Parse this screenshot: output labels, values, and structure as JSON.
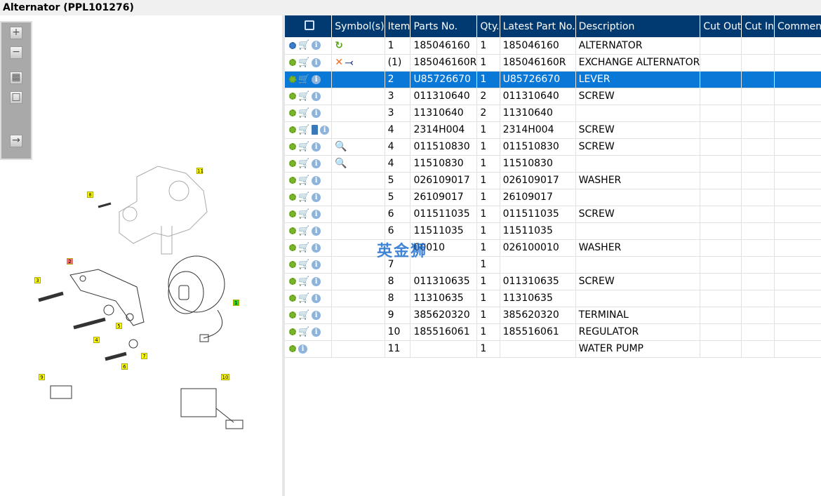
{
  "title": "Alternator (PPL101276)",
  "watermark": "英金狮",
  "toolbar": [
    "zoom-in",
    "zoom-out",
    "fit-all",
    "fit-window",
    "export"
  ],
  "callouts": [
    {
      "label": "11",
      "color": "#ffff00"
    },
    {
      "label": "8",
      "color": "#ffff00"
    },
    {
      "label": "2",
      "color": "#ff6a6a"
    },
    {
      "label": "3",
      "color": "#ffff00"
    },
    {
      "label": "1",
      "color": "#22dd22"
    },
    {
      "label": "5",
      "color": "#ffff00"
    },
    {
      "label": "4",
      "color": "#ffff00"
    },
    {
      "label": "7",
      "color": "#ffff00"
    },
    {
      "label": "6",
      "color": "#ffff00"
    },
    {
      "label": "9",
      "color": "#ffff00"
    },
    {
      "label": "10",
      "color": "#ffff00"
    }
  ],
  "columns": [
    "",
    "Symbol(s)",
    "Item",
    "Parts No.",
    "Qty.",
    "Latest Part No.",
    "Description",
    "Cut Out",
    "Cut In",
    "Comment"
  ],
  "rows": [
    {
      "icons": [
        "gears",
        "cart",
        "info"
      ],
      "symbols": [
        "rotate"
      ],
      "item": "1",
      "part": "185046160",
      "qty": "1",
      "latest": "185046160",
      "desc": "ALTERNATOR"
    },
    {
      "icons": [
        "gear",
        "cart",
        "info"
      ],
      "symbols": [
        "cross",
        "branch"
      ],
      "item": "(1)",
      "part": "185046160R",
      "qty": "1",
      "latest": "185046160R",
      "desc": "EXCHANGE ALTERNATOR"
    },
    {
      "icons": [
        "gear",
        "cart",
        "info"
      ],
      "symbols": [],
      "item": "2",
      "part": "U85726670",
      "qty": "1",
      "latest": "U85726670",
      "desc": "LEVER",
      "selected": true
    },
    {
      "icons": [
        "gear",
        "cart",
        "info"
      ],
      "symbols": [],
      "item": "3",
      "part": "011310640",
      "qty": "2",
      "latest": "011310640",
      "desc": "SCREW"
    },
    {
      "icons": [
        "gear",
        "cart",
        "info"
      ],
      "symbols": [],
      "item": "3",
      "part": "11310640",
      "qty": "2",
      "latest": "11310640",
      "desc": ""
    },
    {
      "icons": [
        "gear",
        "cart",
        "book",
        "info"
      ],
      "symbols": [],
      "item": "4",
      "part": "2314H004",
      "qty": "1",
      "latest": "2314H004",
      "desc": "SCREW"
    },
    {
      "icons": [
        "gear",
        "cart",
        "info"
      ],
      "symbols": [
        "lookup"
      ],
      "item": "4",
      "part": "011510830",
      "qty": "1",
      "latest": "011510830",
      "desc": "SCREW"
    },
    {
      "icons": [
        "gear",
        "cart",
        "info"
      ],
      "symbols": [
        "lookup"
      ],
      "item": "4",
      "part": "11510830",
      "qty": "1",
      "latest": "11510830",
      "desc": ""
    },
    {
      "icons": [
        "gear",
        "cart",
        "info"
      ],
      "symbols": [],
      "item": "5",
      "part": "026109017",
      "qty": "1",
      "latest": "026109017",
      "desc": "WASHER"
    },
    {
      "icons": [
        "gear",
        "cart",
        "info"
      ],
      "symbols": [],
      "item": "5",
      "part": "26109017",
      "qty": "1",
      "latest": "26109017",
      "desc": ""
    },
    {
      "icons": [
        "gear",
        "cart",
        "info"
      ],
      "symbols": [],
      "item": "6",
      "part": "011511035",
      "qty": "1",
      "latest": "011511035",
      "desc": "SCREW"
    },
    {
      "icons": [
        "gear",
        "cart",
        "info"
      ],
      "symbols": [],
      "item": "6",
      "part": "11511035",
      "qty": "1",
      "latest": "11511035",
      "desc": ""
    },
    {
      "icons": [
        "gear",
        "cart",
        "info"
      ],
      "symbols": [],
      "item": "",
      "part": "00010",
      "qty": "1",
      "latest": "026100010",
      "desc": "WASHER"
    },
    {
      "icons": [
        "gear",
        "cart",
        "info"
      ],
      "symbols": [],
      "item": "7",
      "part": "",
      "qty": "1",
      "latest": "",
      "desc": ""
    },
    {
      "icons": [
        "gear",
        "cart",
        "info"
      ],
      "symbols": [],
      "item": "8",
      "part": "011310635",
      "qty": "1",
      "latest": "011310635",
      "desc": "SCREW"
    },
    {
      "icons": [
        "gear",
        "cart",
        "info"
      ],
      "symbols": [],
      "item": "8",
      "part": "11310635",
      "qty": "1",
      "latest": "11310635",
      "desc": ""
    },
    {
      "icons": [
        "gear",
        "cart",
        "info"
      ],
      "symbols": [],
      "item": "9",
      "part": "385620320",
      "qty": "1",
      "latest": "385620320",
      "desc": "TERMINAL"
    },
    {
      "icons": [
        "gear",
        "cart",
        "info"
      ],
      "symbols": [],
      "item": "10",
      "part": "185516061",
      "qty": "1",
      "latest": "185516061",
      "desc": "REGULATOR"
    },
    {
      "icons": [
        "gear",
        "info"
      ],
      "symbols": [],
      "item": "11",
      "part": "",
      "qty": "1",
      "latest": "",
      "desc": "WATER PUMP"
    }
  ]
}
